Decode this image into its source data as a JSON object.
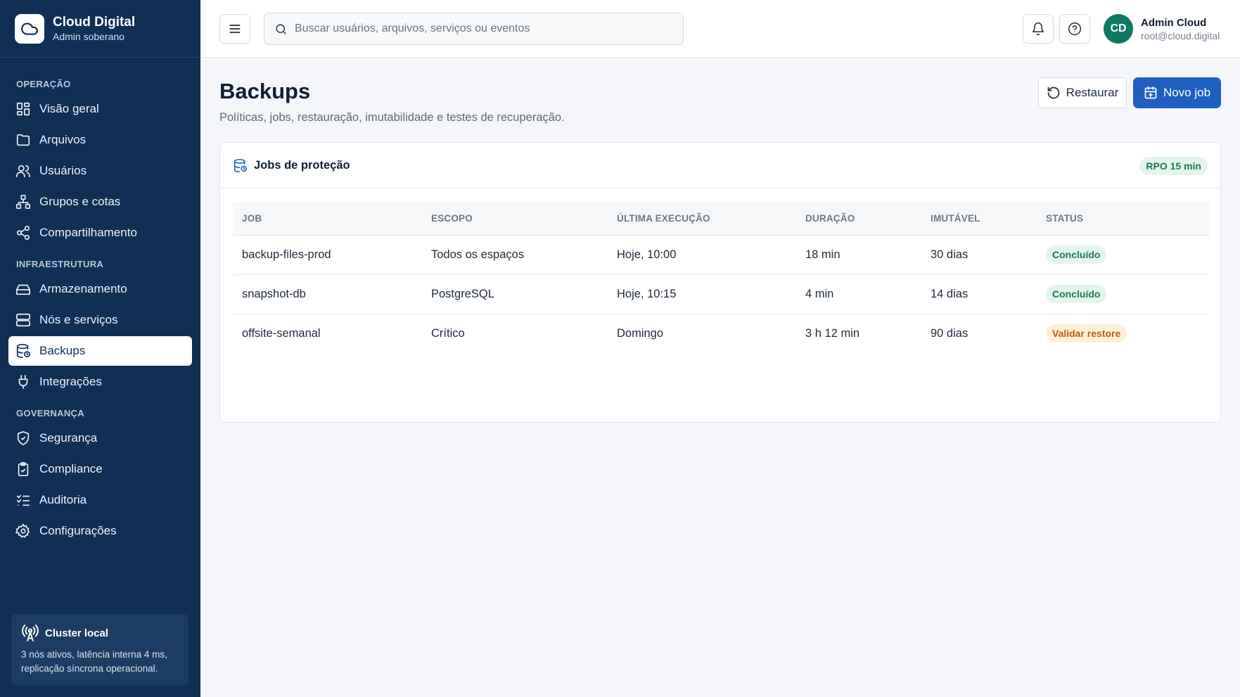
{
  "brand": {
    "title": "Cloud Digital",
    "subtitle": "Admin soberano",
    "logo_icon": "cloud-icon"
  },
  "sidebar": {
    "sections": [
      {
        "label": "OPERAÇÃO",
        "items": [
          {
            "label": "Visão geral",
            "icon": "dashboard-icon"
          },
          {
            "label": "Arquivos",
            "icon": "folder-icon"
          },
          {
            "label": "Usuários",
            "icon": "users-icon"
          },
          {
            "label": "Grupos e cotas",
            "icon": "network-icon"
          },
          {
            "label": "Compartilhamento",
            "icon": "share-icon"
          }
        ]
      },
      {
        "label": "INFRAESTRUTURA",
        "items": [
          {
            "label": "Armazenamento",
            "icon": "hard-drive-icon"
          },
          {
            "label": "Nós e serviços",
            "icon": "server-icon"
          },
          {
            "label": "Backups",
            "icon": "database-backup-icon",
            "active": true
          },
          {
            "label": "Integrações",
            "icon": "plug-icon"
          }
        ]
      },
      {
        "label": "GOVERNANÇA",
        "items": [
          {
            "label": "Segurança",
            "icon": "shield-icon"
          },
          {
            "label": "Compliance",
            "icon": "clipboard-check-icon"
          },
          {
            "label": "Auditoria",
            "icon": "list-checks-icon"
          },
          {
            "label": "Configurações",
            "icon": "gear-icon"
          }
        ]
      }
    ],
    "cluster": {
      "title": "Cluster local",
      "text": "3 nós ativos, latência interna 4 ms, replicação síncrona operacional.",
      "icon": "radio-tower-icon"
    }
  },
  "topbar": {
    "search_placeholder": "Buscar usuários, arquivos, serviços ou eventos",
    "user": {
      "initials": "CD",
      "name": "Admin Cloud",
      "email": "root@cloud.digital"
    }
  },
  "page": {
    "title": "Backups",
    "subtitle": "Políticas, jobs, restauração, imutabilidade e testes de recuperação.",
    "restore_label": "Restaurar",
    "new_job_label": "Novo job"
  },
  "card": {
    "title": "Jobs de proteção",
    "badge": "RPO 15 min",
    "columns": [
      "JOB",
      "ESCOPO",
      "ÚLTIMA EXECUÇÃO",
      "DURAÇÃO",
      "IMUTÁVEL",
      "STATUS"
    ],
    "rows": [
      {
        "job": "backup-files-prod",
        "scope": "Todos os espaços",
        "last_run": "Hoje, 10:00",
        "duration": "18 min",
        "immutable": "30 dias",
        "status": "Concluído",
        "status_type": "ok"
      },
      {
        "job": "snapshot-db",
        "scope": "PostgreSQL",
        "last_run": "Hoje, 10:15",
        "duration": "4 min",
        "immutable": "14 dias",
        "status": "Concluído",
        "status_type": "ok"
      },
      {
        "job": "offsite-semanal",
        "scope": "Crítico",
        "last_run": "Domingo",
        "duration": "3 h 12 min",
        "immutable": "90 dias",
        "status": "Validar restore",
        "status_type": "warn"
      }
    ]
  },
  "colors": {
    "sidebar": "#0f2f55",
    "primary": "#1f5fbf",
    "success_bg": "#e3f5ec",
    "success_text": "#1b7a4e",
    "warn_bg": "#fdf0d6",
    "warn_text": "#b4620f"
  }
}
